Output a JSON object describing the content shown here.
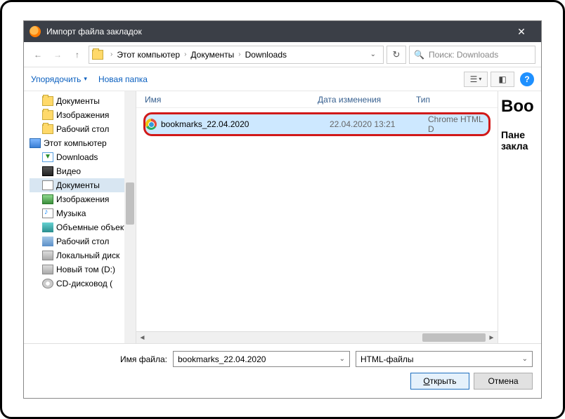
{
  "titlebar": {
    "title": "Импорт файла закладок",
    "close": "✕"
  },
  "nav": {
    "crumbs": [
      "Этот компьютер",
      "Документы",
      "Downloads"
    ],
    "search_placeholder": "Поиск: Downloads"
  },
  "toolbar": {
    "organize": "Упорядочить",
    "newfolder": "Новая папка"
  },
  "tree": {
    "items": [
      {
        "icon": "ic-folder",
        "label": "Документы",
        "indent": true
      },
      {
        "icon": "ic-folder",
        "label": "Изображения",
        "indent": true
      },
      {
        "icon": "ic-folder",
        "label": "Рабочий стол",
        "indent": true
      },
      {
        "icon": "ic-pc",
        "label": "Этот компьютер",
        "indent": false
      },
      {
        "icon": "ic-dl",
        "label": "Downloads",
        "indent": true
      },
      {
        "icon": "ic-video",
        "label": "Видео",
        "indent": true
      },
      {
        "icon": "ic-doc",
        "label": "Документы",
        "indent": true,
        "selected": true
      },
      {
        "icon": "ic-img",
        "label": "Изображения",
        "indent": true
      },
      {
        "icon": "ic-music",
        "label": "Музыка",
        "indent": true
      },
      {
        "icon": "ic-3d",
        "label": "Объемные объекты",
        "indent": true
      },
      {
        "icon": "ic-desk",
        "label": "Рабочий стол",
        "indent": true
      },
      {
        "icon": "ic-drive",
        "label": "Локальный диск",
        "indent": true
      },
      {
        "icon": "ic-drive",
        "label": "Новый том (D:)",
        "indent": true
      },
      {
        "icon": "ic-cd",
        "label": "CD-дисковод (",
        "indent": true
      }
    ]
  },
  "columns": {
    "name": "Имя",
    "date": "Дата изменения",
    "type": "Тип"
  },
  "files": [
    {
      "name": "bookmarks_22.04.2020",
      "date": "22.04.2020 13:21",
      "type": "Chrome HTML D",
      "selected": true
    }
  ],
  "preview": {
    "h1": "Boo",
    "h3a": "Пане",
    "h3b": "закла"
  },
  "bottom": {
    "filename_label": "Имя файла:",
    "filename_value": "bookmarks_22.04.2020",
    "filetype": "HTML-файлы",
    "open": "Открыть",
    "open_ul": "О",
    "cancel": "Отмена"
  }
}
